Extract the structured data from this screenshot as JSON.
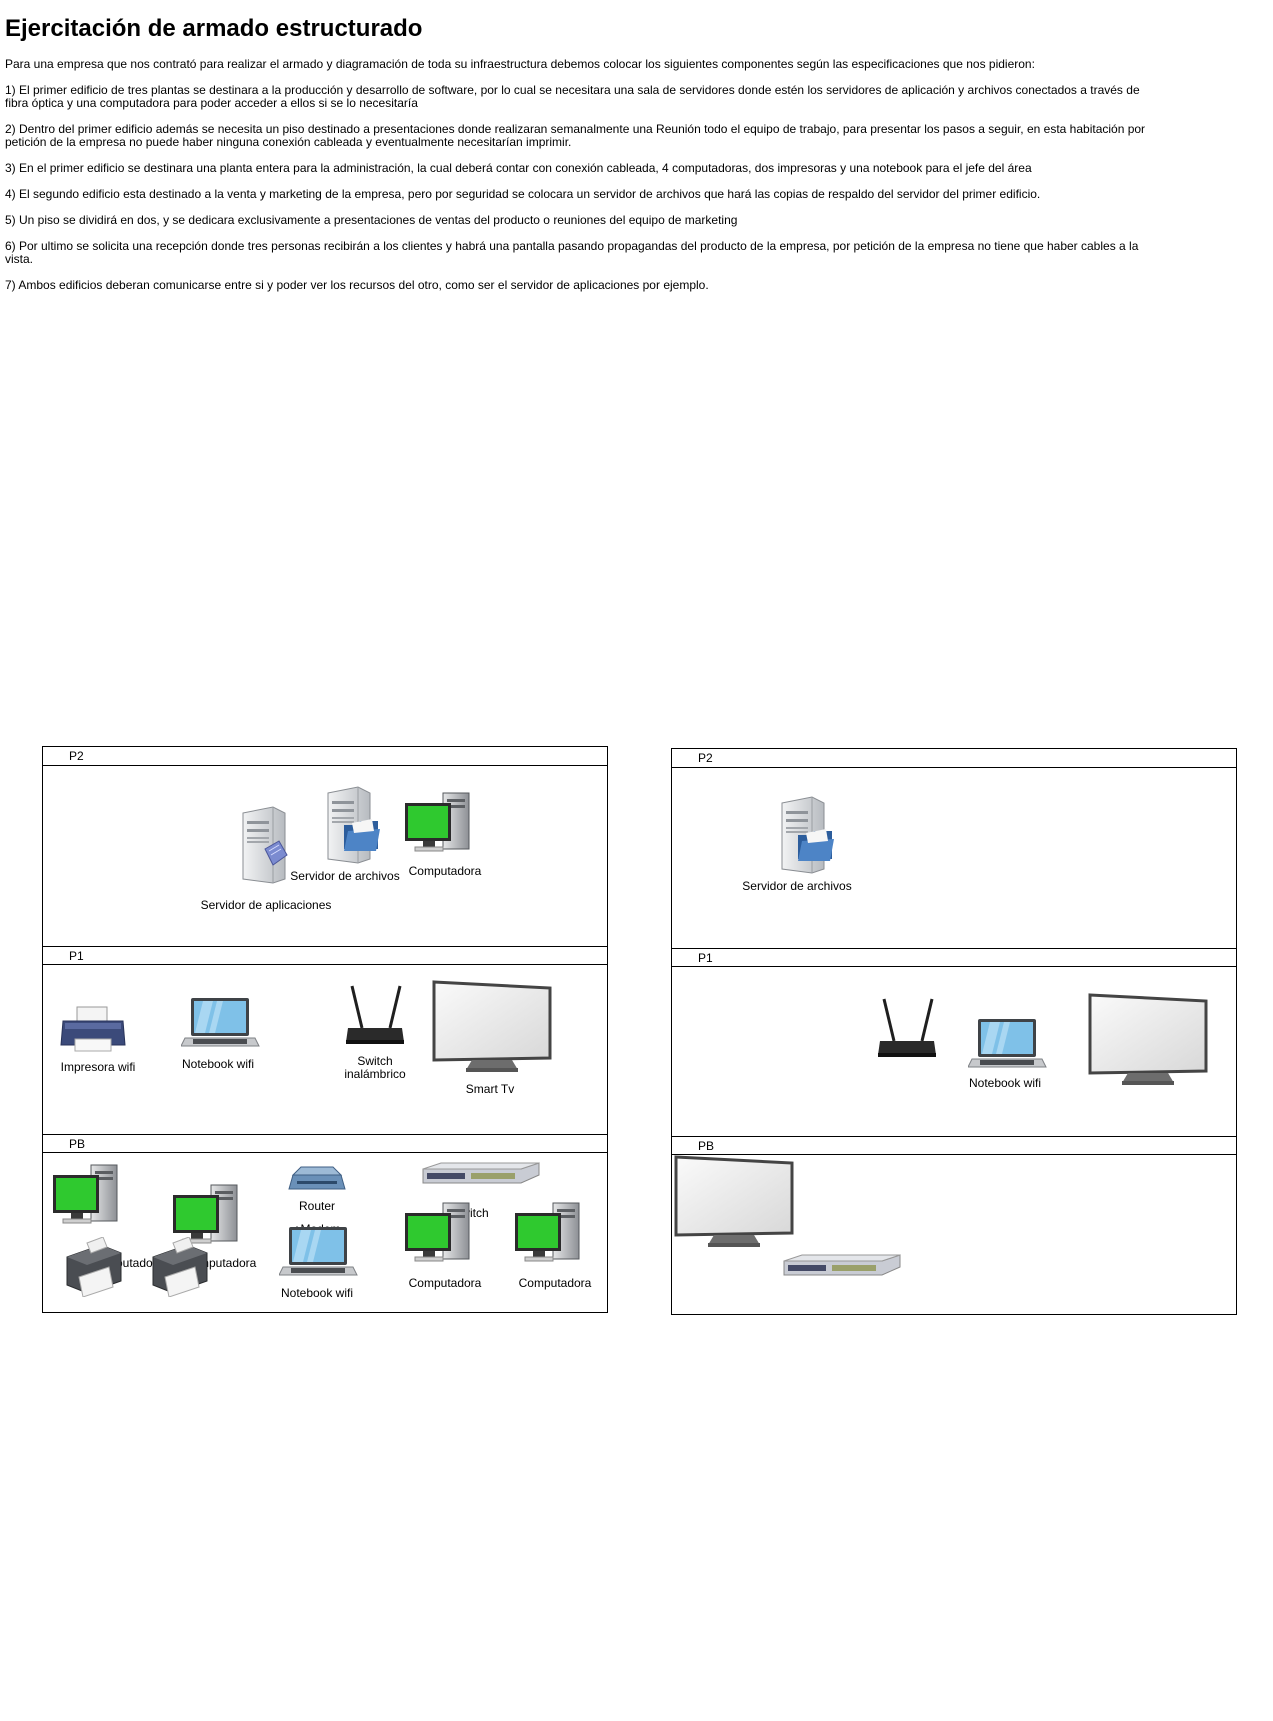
{
  "document": {
    "title": "Ejercitación de armado estructurado",
    "intro": "Para una empresa que  nos contrató para realizar el armado y diagramación de toda su infraestructura debemos colocar los siguientes componentes según las especificaciones que nos pidieron:",
    "items": [
      "1) El primer edificio de tres plantas se destinara a la producción y desarrollo de software, por lo cual se necesitara una sala de servidores donde estén los servidores de aplicación y archivos conectados a través de fibra óptica y una computadora para poder acceder a ellos si se lo necesitaría",
      "2) Dentro del primer edificio además se necesita un piso destinado a presentaciones donde realizaran semanalmente una Reunión todo el equipo de trabajo, para presentar los pasos a seguir, en esta habitación por petición de la empresa no puede haber ninguna conexión cableada y eventualmente necesitarían imprimir.",
      "3) En el primer edificio se destinara una planta entera para la administración, la cual deberá contar con conexión cableada, 4 computadoras, dos impresoras y una notebook para el jefe del área",
      "4) El segundo edificio esta destinado a la venta y marketing de la empresa, pero por seguridad se colocara un servidor de archivos que hará las copias de respaldo del servidor del primer edificio.",
      "5) Un piso se dividirá en dos, y se dedicara exclusivamente a presentaciones de ventas del producto o reuniones del equipo de marketing",
      "6) Por ultimo se solicita una recepción donde tres personas recibirán a los clientes y habrá una pantalla pasando propagandas del producto de la empresa, por petición de la empresa no tiene que haber cables a la vista.",
      "7) Ambos edificios deberan comunicarse entre si y poder ver los recursos del otro, como ser el servidor de aplicaciones por ejemplo."
    ]
  },
  "building1": {
    "floor_p2": "P2",
    "floor_p1": "P1",
    "floor_pb": "PB",
    "p2": {
      "app_server": "Servidor de aplicaciones",
      "file_server": "Servidor de archivos",
      "computer": "Computadora"
    },
    "p1": {
      "printer": "Impresora wifi",
      "notebook": "Notebook wifi",
      "switch_line1": "Switch",
      "switch_line2": "inalámbrico",
      "tv": "Smart Tv"
    },
    "pb": {
      "computer_1": "Computadora",
      "computer_2": "Computadora",
      "router_line1": "Router",
      "router_line2": "+Modem",
      "switch": "Switch",
      "notebook": "Notebook wifi",
      "computer_3": "Computadora",
      "computer_4": "Computadora"
    }
  },
  "building2": {
    "floor_p2": "P2",
    "floor_p1": "P1",
    "floor_pb": "PB",
    "p2": {
      "file_server": "Servidor de archivos"
    },
    "p1": {
      "notebook": "Notebook wifi"
    }
  },
  "colors": {
    "monitor_screen": "#2fc92f",
    "server_body": "#cfd2d6",
    "laptop_screen": "#7fc1e8",
    "printer_body": "#3b4a7a",
    "folder": "#3a6fb0"
  }
}
